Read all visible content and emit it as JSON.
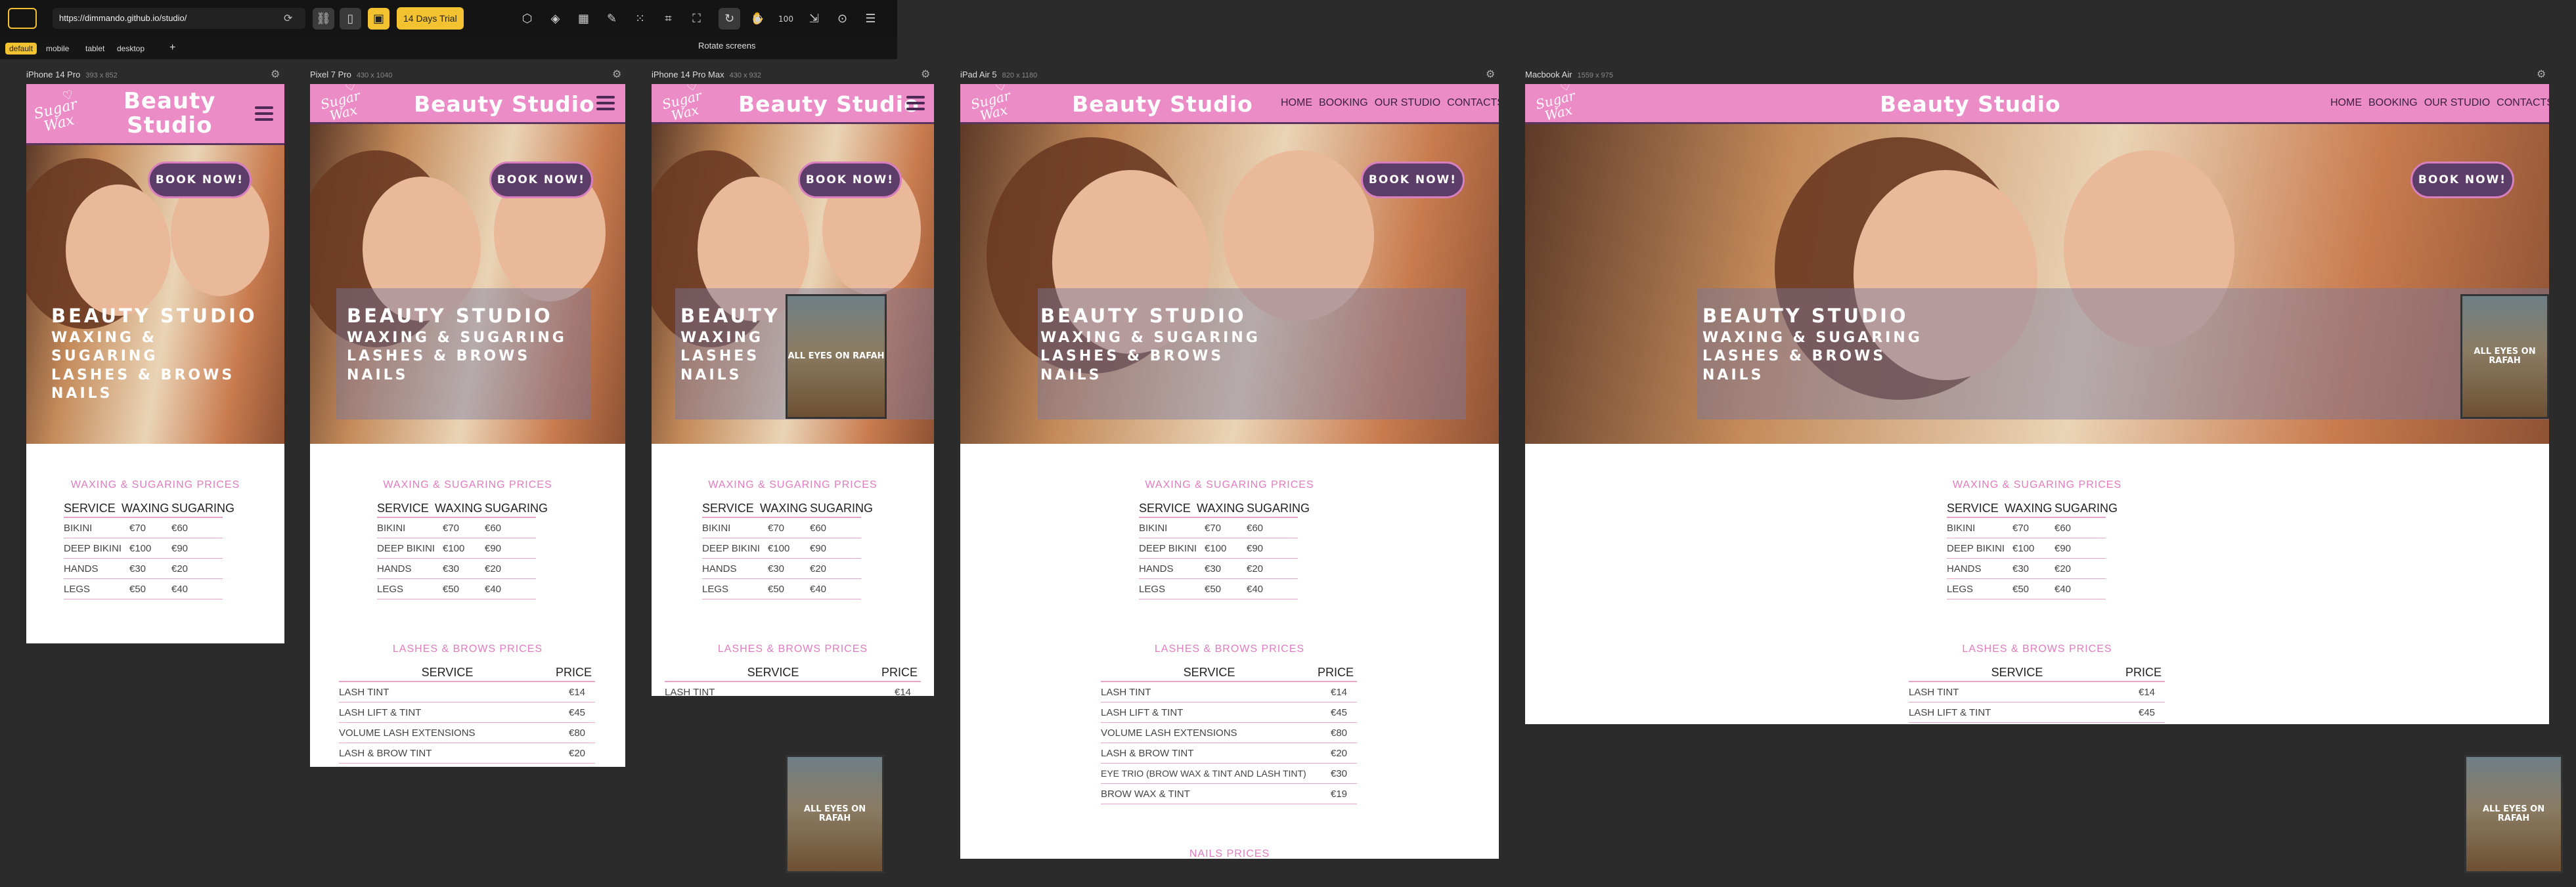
{
  "toolbar": {
    "url": "https://dimmando.github.io/studio/",
    "trial_label": "14 Days Trial",
    "zoom_label": "100",
    "tooltip": "Rotate screens"
  },
  "screen_tabs": [
    "default",
    "mobile",
    "tablet",
    "desktop"
  ],
  "devices": [
    {
      "name": "iPhone 14 Pro",
      "size": "393 x 852"
    },
    {
      "name": "Pixel 7 Pro",
      "size": "430 x 1040"
    },
    {
      "name": "iPhone 14 Pro Max",
      "size": "430 x 932"
    },
    {
      "name": "iPad Air 5",
      "size": "820 x 1180"
    },
    {
      "name": "Macbook Air",
      "size": "1559 x 975"
    }
  ],
  "site": {
    "logo_line1": "Sugar",
    "logo_line2": "Wax",
    "brand_line1": "Beauty",
    "brand_line2": "Studio",
    "brand": "Beauty Studio",
    "nav": [
      "HOME",
      "BOOKING",
      "OUR STUDIO",
      "CONTACTS"
    ],
    "book_now": "BOOK NOW!",
    "hero_title": "BEAUTY STUDIO",
    "hero_lines": [
      "WAXING & SUGARING",
      "LASHES & BROWS",
      "NAILS"
    ],
    "hero_lines_narrow": [
      "WAXING &",
      "SUGARING",
      "LASHES & BROWS",
      "NAILS"
    ],
    "hero_title_short": "BEAUTY",
    "hero_lines_short": [
      "WAXING",
      "LASHES",
      "NAILS"
    ],
    "rafah_text": "ALL EYES ON RAFAH",
    "waxing_title": "WAXING & SUGARING PRICES",
    "waxing_headers": [
      "SERVICE",
      "WAXING",
      "SUGARING"
    ],
    "waxing_rows": [
      [
        "BIKINI",
        "€70",
        "€60"
      ],
      [
        "DEEP BIKINI",
        "€100",
        "€90"
      ],
      [
        "HANDS",
        "€30",
        "€20"
      ],
      [
        "LEGS",
        "€50",
        "€40"
      ]
    ],
    "lashes_title": "LASHES & BROWS PRICES",
    "lashes_headers": [
      "SERVICE",
      "PRICE"
    ],
    "lashes_rows": [
      [
        "LASH TINT",
        "€14"
      ],
      [
        "LASH LIFT & TINT",
        "€45"
      ],
      [
        "VOLUME LASH EXTENSIONS",
        "€80"
      ],
      [
        "LASH & BROW TINT",
        "€20"
      ],
      [
        "EYE TRIO (BROW WAX & TINT AND LASH TINT)",
        "€30"
      ],
      [
        "BROW WAX & TINT",
        "€19"
      ]
    ],
    "nails_title": "NAILS PRICES"
  }
}
